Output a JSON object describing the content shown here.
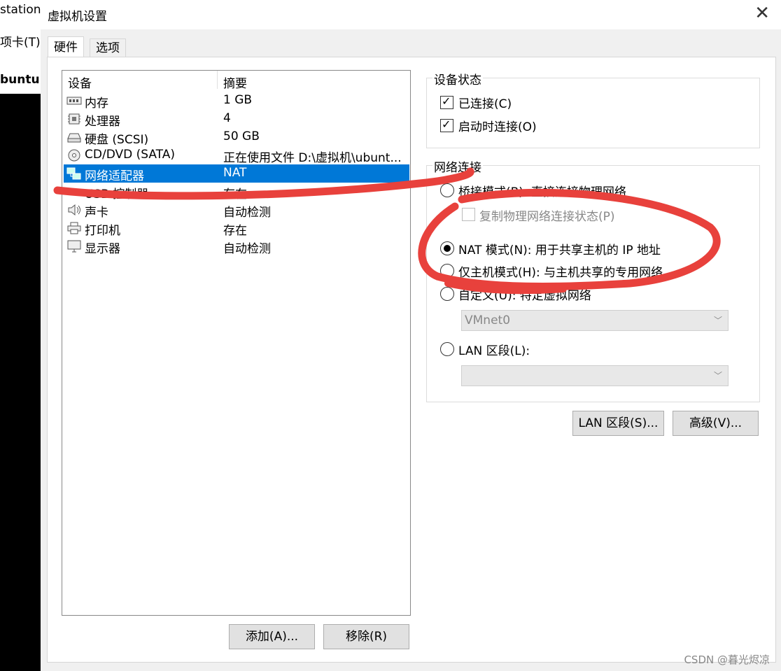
{
  "background_app": {
    "line1": "station",
    "line2": "项卡(T)",
    "line3": "buntu s"
  },
  "dialog": {
    "title": "虚拟机设置",
    "close_glyph": "✕",
    "tabs": [
      {
        "label": "硬件",
        "active": true
      },
      {
        "label": "选项",
        "active": false
      }
    ]
  },
  "device_list": {
    "headers": {
      "device": "设备",
      "summary": "摘要"
    },
    "rows": [
      {
        "icon": "memory-icon",
        "name": "内存",
        "summary": "1 GB",
        "selected": false
      },
      {
        "icon": "processor-icon",
        "name": "处理器",
        "summary": "4",
        "selected": false
      },
      {
        "icon": "hard-disk-icon",
        "name": "硬盘 (SCSI)",
        "summary": "50 GB",
        "selected": false
      },
      {
        "icon": "cd-dvd-icon",
        "name": "CD/DVD (SATA)",
        "summary": "正在使用文件 D:\\虚拟机\\ubunt...",
        "selected": false
      },
      {
        "icon": "network-adapter-icon",
        "name": "网络适配器",
        "summary": "NAT",
        "selected": true
      },
      {
        "icon": "usb-controller-icon",
        "name": "USB 控制器",
        "summary": "存在",
        "selected": false
      },
      {
        "icon": "sound-card-icon",
        "name": "声卡",
        "summary": "自动检测",
        "selected": false
      },
      {
        "icon": "printer-icon",
        "name": "打印机",
        "summary": "存在",
        "selected": false
      },
      {
        "icon": "display-icon",
        "name": "显示器",
        "summary": "自动检测",
        "selected": false
      }
    ],
    "add_button": "添加(A)...",
    "remove_button": "移除(R)"
  },
  "device_status": {
    "group_label": "设备状态",
    "connected": {
      "label": "已连接(C)",
      "checked": true
    },
    "connect_at_power_on": {
      "label": "启动时连接(O)",
      "checked": true
    }
  },
  "network_connection": {
    "group_label": "网络连接",
    "bridged": {
      "label": "桥接模式(B): 直接连接物理网络",
      "selected": false
    },
    "replicate": {
      "label": "复制物理网络连接状态(P)",
      "checked": false,
      "enabled": false
    },
    "nat": {
      "label": "NAT 模式(N): 用于共享主机的 IP 地址",
      "selected": true
    },
    "host_only": {
      "label": "仅主机模式(H): 与主机共享的专用网络",
      "selected": false
    },
    "custom": {
      "label": "自定义(U): 特定虚拟网络",
      "selected": false
    },
    "custom_select": "VMnet0",
    "lan_segment": {
      "label": "LAN 区段(L):",
      "selected": false
    },
    "lan_select": ""
  },
  "buttons": {
    "lan_segments": "LAN 区段(S)...",
    "advanced": "高级(V)..."
  },
  "watermark": "CSDN @暮光烬凉",
  "colors": {
    "selection": "#0078d7",
    "scribble": "#e8413c"
  }
}
